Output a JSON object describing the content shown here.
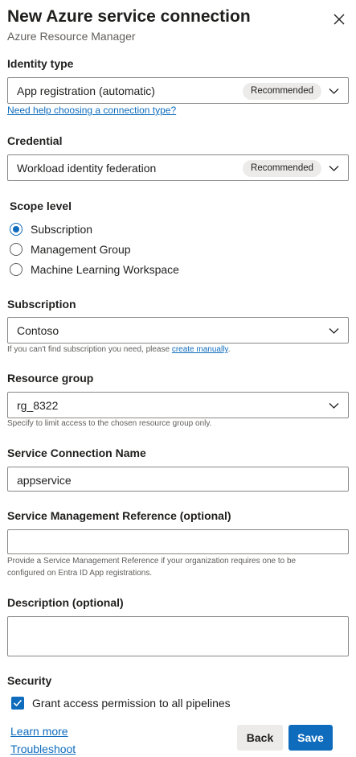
{
  "header": {
    "title": "New Azure service connection",
    "subtitle": "Azure Resource Manager"
  },
  "identity_type": {
    "label": "Identity type",
    "value": "App registration (automatic)",
    "badge": "Recommended",
    "help_link": "Need help choosing a connection type?"
  },
  "credential": {
    "label": "Credential",
    "value": "Workload identity federation",
    "badge": "Recommended"
  },
  "scope": {
    "label": "Scope level",
    "options": [
      {
        "label": "Subscription",
        "selected": true
      },
      {
        "label": "Management Group",
        "selected": false
      },
      {
        "label": "Machine Learning Workspace",
        "selected": false
      }
    ]
  },
  "subscription": {
    "label": "Subscription",
    "value": "Contoso",
    "hint_prefix": "If you can't find subscription you need, please ",
    "hint_link": "create manually",
    "hint_suffix": "."
  },
  "resource_group": {
    "label": "Resource group",
    "value": "rg_8322",
    "hint": "Specify to limit access to the chosen resource group only."
  },
  "connection_name": {
    "label": "Service Connection Name",
    "value": "appservice"
  },
  "management_reference": {
    "label": "Service Management Reference (optional)",
    "value": "",
    "hint_line1": "Provide a Service Management Reference if your organization requires one to be",
    "hint_line2": "configured on Entra ID App registrations."
  },
  "description": {
    "label": "Description (optional)",
    "value": ""
  },
  "security": {
    "label": "Security",
    "checkbox_label": "Grant access permission to all pipelines",
    "checked": true
  },
  "footer": {
    "learn_more": "Learn more",
    "troubleshoot": "Troubleshoot",
    "back": "Back",
    "save": "Save"
  },
  "colors": {
    "accent": "#0f6cbd",
    "badge_bg": "#edebe9",
    "border": "#8a8886"
  },
  "icons": {
    "close": "close-icon",
    "dropdown": "chevron-down-icon",
    "check": "checkmark-icon"
  }
}
